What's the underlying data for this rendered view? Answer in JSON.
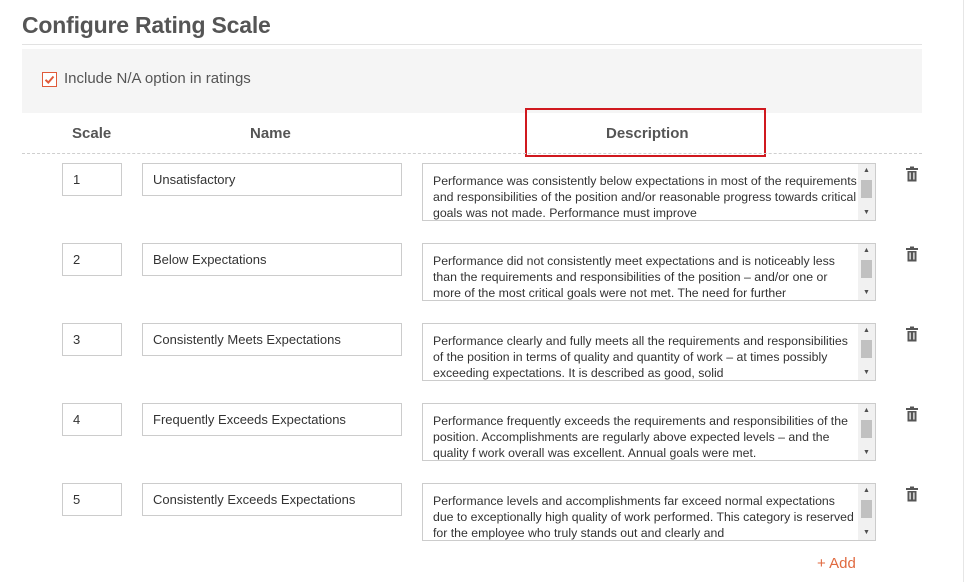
{
  "page_title": "Configure Rating Scale",
  "na_option": {
    "label": "Include N/A option in ratings",
    "checked": true
  },
  "columns": {
    "scale": "Scale",
    "name": "Name",
    "description": "Description"
  },
  "rows": [
    {
      "scale": "1",
      "name": "Unsatisfactory",
      "description": "Performance was consistently below expectations in most of the requirements and responsibilities of the position and/or reasonable progress towards critical goals was not made. Performance must improve"
    },
    {
      "scale": "2",
      "name": "Below Expectations",
      "description": "Performance did not consistently meet expectations and is noticeably less than the requirements and responsibilities of the position – and/or one or more of the most critical goals were not met. The need for further"
    },
    {
      "scale": "3",
      "name": "Consistently Meets Expectations",
      "description": "Performance clearly and fully meets all the requirements and responsibilities of the position in terms of quality and quantity of work – at times possibly exceeding expectations. It is described as good, solid"
    },
    {
      "scale": "4",
      "name": "Frequently Exceeds Expectations",
      "description": "Performance frequently exceeds the requirements and responsibilities of the position. Accomplishments are regularly above expected levels – and the quality f work overall was excellent. Annual goals were met."
    },
    {
      "scale": "5",
      "name": "Consistently Exceeds Expectations",
      "description": "Performance levels and accomplishments far exceed normal expectations due to exceptionally high quality of work performed. This category is reserved for the employee who truly stands out and clearly and"
    }
  ],
  "add_label": "+ Add",
  "colors": {
    "accent": "#e05a3a",
    "highlight": "#d0191f",
    "link": "#e0693f"
  },
  "icons": {
    "checkbox": "checkmark-icon",
    "delete": "trash-icon"
  }
}
